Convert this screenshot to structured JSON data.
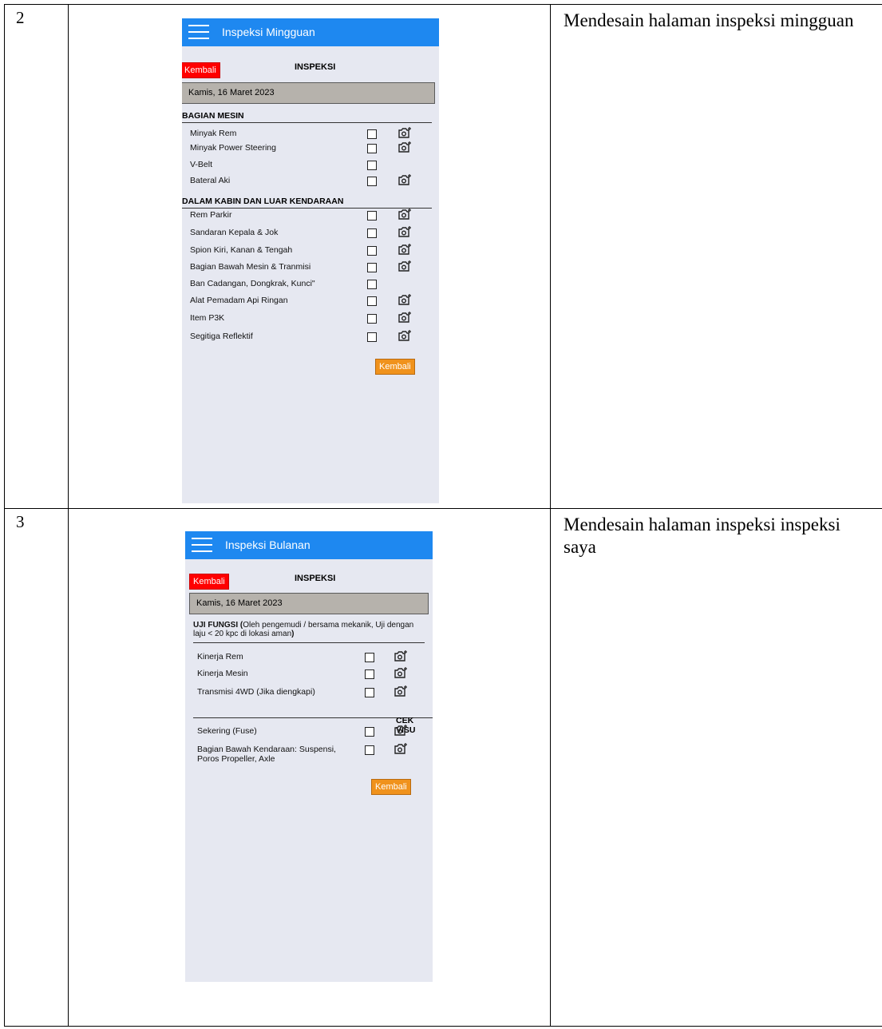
{
  "rows": [
    {
      "number": "2",
      "description": "Mendesain halaman inspeksi mingguan",
      "screen": {
        "app_title": "Inspeksi Mingguan",
        "back_button_top": "Kembali",
        "header": "INSPEKSI",
        "date": "Kamis, 16 Maret 2023",
        "sections": [
          {
            "title": "BAGIAN MESIN",
            "items": [
              {
                "label": "Minyak Rem",
                "camera": true
              },
              {
                "label": "Minyak Power Steering",
                "camera": true
              },
              {
                "label": "V-Belt",
                "camera": false
              },
              {
                "label": "Bateral Aki",
                "camera": true
              }
            ]
          },
          {
            "title": "DALAM KABIN DAN LUAR KENDARAAN",
            "items": [
              {
                "label": "Rem Parkir",
                "camera": true
              },
              {
                "label": "Sandaran Kepala & Jok",
                "camera": true
              },
              {
                "label": "Spion Kiri, Kanan & Tengah",
                "camera": true
              },
              {
                "label": "Bagian Bawah Mesin & Tranmisi",
                "camera": true
              },
              {
                "label": "Ban Cadangan, Dongkrak, Kunci\"",
                "camera": false
              },
              {
                "label": "Alat Pemadam Api Ringan",
                "camera": true
              },
              {
                "label": "Item P3K",
                "camera": true
              },
              {
                "label": "Segitiga Reflektif",
                "camera": true
              }
            ]
          }
        ],
        "back_button_bottom": "Kembali"
      }
    },
    {
      "number": "3",
      "description": "Mendesain halaman inspeksi inspeksi saya",
      "screen": {
        "app_title": "Inspeksi Bulanan",
        "back_button_top": "Kembali",
        "header": "INSPEKSI",
        "date": "Kamis, 16 Maret 2023",
        "section_bold": "UJI FUNGSI (",
        "section_note": "Oleh pengemudi / bersama mekanik, Uji dengan laju < 20 kpc di lokasi aman",
        "section_close": ")",
        "items_a": [
          {
            "label": "Kinerja Rem",
            "camera": true
          },
          {
            "label": "Kinerja Mesin",
            "camera": true
          },
          {
            "label": "Transmisi 4WD (Jika diengkapi)",
            "camera": true
          }
        ],
        "section2_title": "CEK VISU",
        "items_b": [
          {
            "label": "Sekering (Fuse)",
            "camera": true
          },
          {
            "label": "Bagian Bawah Kendaraan: Suspensi, Poros Propeller, Axle",
            "camera": true
          }
        ],
        "back_button_bottom": "Kembali"
      }
    }
  ]
}
